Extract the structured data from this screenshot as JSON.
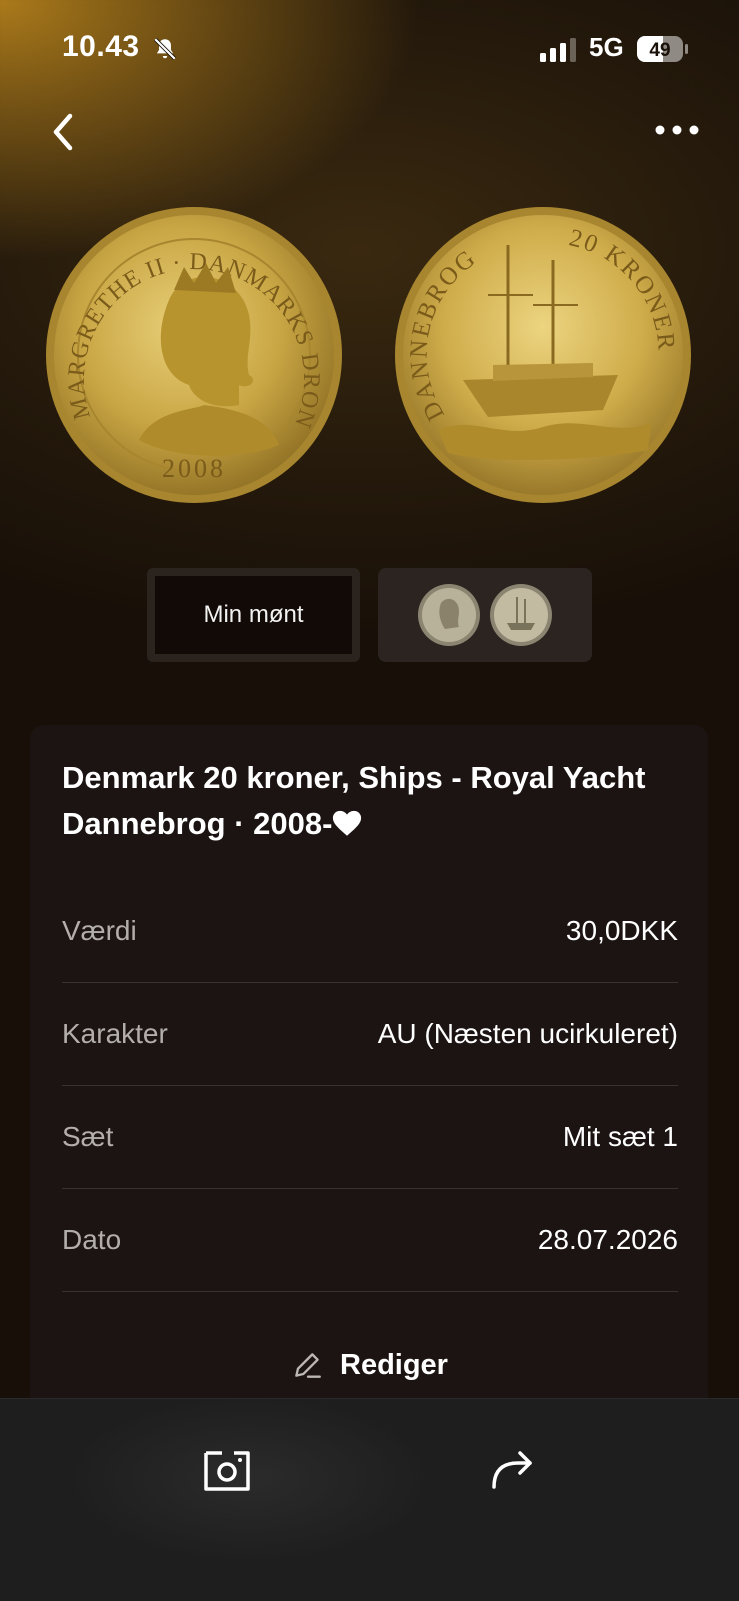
{
  "status": {
    "time": "10.43",
    "network": "5G",
    "battery": "49"
  },
  "nav": {
    "back_icon": "chevron-left-icon",
    "more_icon": "ellipsis-icon"
  },
  "images": {
    "obverse_inscription": "MARGRETHE II · DANMARKS DRONNING",
    "obverse_year": "2008",
    "reverse_inscription_left": "DANNEBROG",
    "reverse_inscription_right": "20 KRONER"
  },
  "thumbs": {
    "mine_label": "Min mønt"
  },
  "coin": {
    "title": "Denmark 20 kroner, Ships - Royal Yacht Dannebrog · 2008-"
  },
  "details": [
    {
      "key": "Værdi",
      "value": "30,0DKK"
    },
    {
      "key": "Karakter",
      "value": "AU (Næsten ucirkuleret)"
    },
    {
      "key": "Sæt",
      "value": "Mit sæt 1"
    },
    {
      "key": "Dato",
      "value": "28.07.2026"
    }
  ],
  "actions": {
    "edit_label": "Rediger"
  },
  "tabbar": {
    "photo_icon": "camera-frame-icon",
    "share_icon": "share-arrow-icon"
  },
  "colors": {
    "gold": "#c9a644",
    "card_bg": "#1b1412",
    "divider": "#3a3230"
  }
}
